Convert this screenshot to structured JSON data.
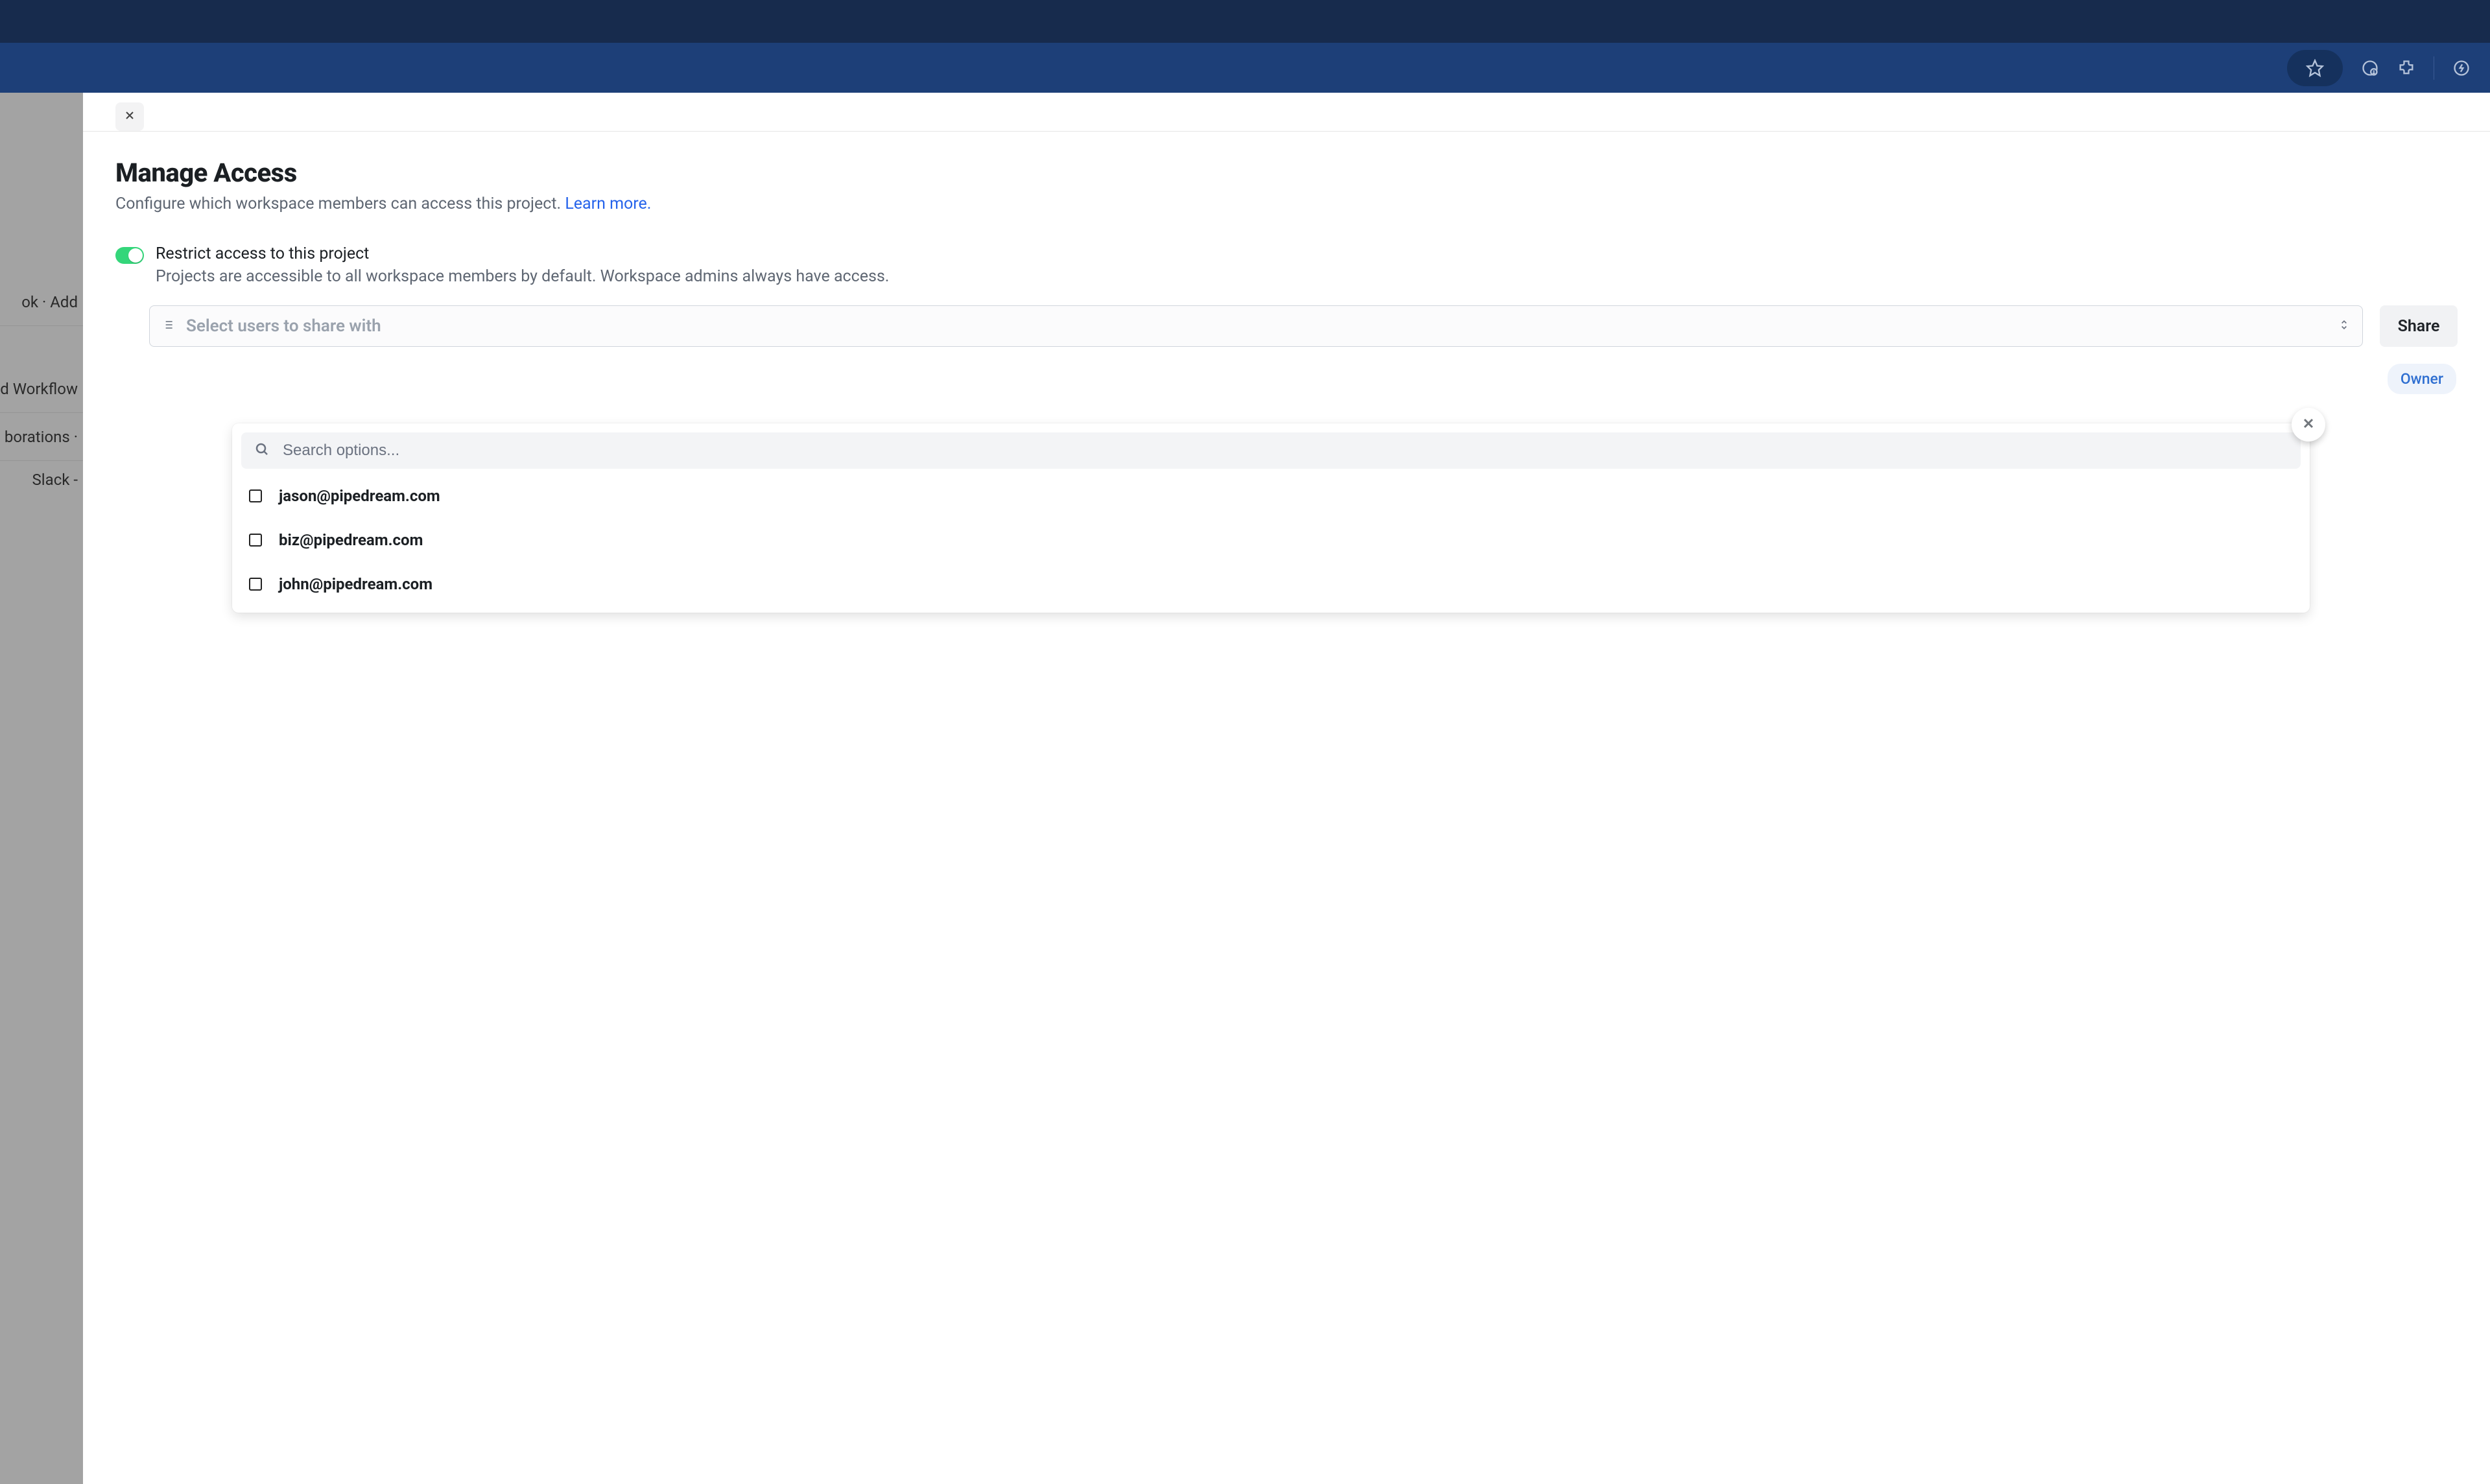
{
  "header": {
    "title": "Manage Access",
    "subtitle_text": "Configure which workspace members can access this project. ",
    "learn_more_label": "Learn more."
  },
  "restrict": {
    "enabled": true,
    "label": "Restrict access to this project",
    "description": "Projects are accessible to all workspace members by default. Workspace admins always have access."
  },
  "select": {
    "placeholder": "Select users to share with",
    "share_button": "Share"
  },
  "owner_badge": "Owner",
  "dropdown": {
    "search_placeholder": "Search options...",
    "options": [
      {
        "label": "jason@pipedream.com"
      },
      {
        "label": "biz@pipedream.com"
      },
      {
        "label": "john@pipedream.com"
      }
    ]
  },
  "sidebar_fragments": [
    "ok  ·     Add",
    "ed Workflow",
    "borations  ·",
    "    Slack -"
  ]
}
